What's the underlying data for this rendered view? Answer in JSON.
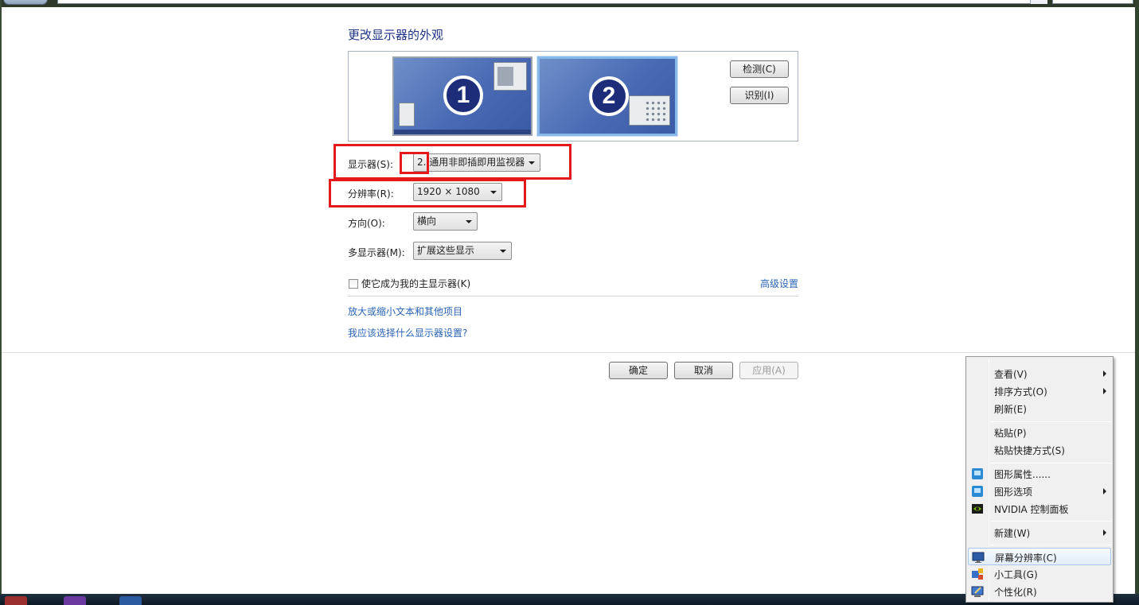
{
  "page": {
    "title": "更改显示器的外观"
  },
  "monitors": [
    {
      "number": "1",
      "selected": false
    },
    {
      "number": "2",
      "selected": true
    }
  ],
  "buttons": {
    "detect": "检测(C)",
    "identify": "识别(I)",
    "ok": "确定",
    "cancel": "取消",
    "apply": "应用(A)"
  },
  "form": {
    "display_label": "显示器(S):",
    "display_value": "2. 通用非即插即用监视器",
    "resolution_label": "分辨率(R):",
    "resolution_value": "1920 × 1080",
    "orientation_label": "方向(O):",
    "orientation_value": "横向",
    "multi_label": "多显示器(M):",
    "multi_value": "扩展这些显示",
    "primary_checkbox_label": "使它成为我的主显示器(K)",
    "primary_checked": false
  },
  "links": {
    "advanced": "高级设置",
    "text_size": "放大或缩小文本和其他项目",
    "which_settings": "我应该选择什么显示器设置?"
  },
  "context_menu": {
    "items": [
      {
        "label": "查看(V)",
        "submenu": true,
        "icon": ""
      },
      {
        "label": "排序方式(O)",
        "submenu": true,
        "icon": ""
      },
      {
        "label": "刷新(E)",
        "submenu": false,
        "icon": ""
      },
      {
        "label": "粘贴(P)",
        "submenu": false,
        "icon": ""
      },
      {
        "label": "粘贴快捷方式(S)",
        "submenu": false,
        "icon": ""
      },
      {
        "label": "图形属性......",
        "submenu": false,
        "icon": "intel-graphics-icon"
      },
      {
        "label": "图形选项",
        "submenu": true,
        "icon": "intel-graphics-icon"
      },
      {
        "label": "NVIDIA 控制面板",
        "submenu": false,
        "icon": "nvidia-icon"
      },
      {
        "label": "新建(W)",
        "submenu": true,
        "icon": ""
      },
      {
        "label": "屏幕分辨率(C)",
        "submenu": false,
        "icon": "screen-resolution-icon",
        "highlighted": true
      },
      {
        "label": "小工具(G)",
        "submenu": false,
        "icon": "gadgets-icon"
      },
      {
        "label": "个性化(R)",
        "submenu": false,
        "icon": "personalize-icon"
      }
    ]
  },
  "colors": {
    "title_blue": "#1e3287",
    "link_blue": "#2a64b5",
    "highlight_red": "#e3191c",
    "monitor_blue": "#4a6ab4"
  }
}
